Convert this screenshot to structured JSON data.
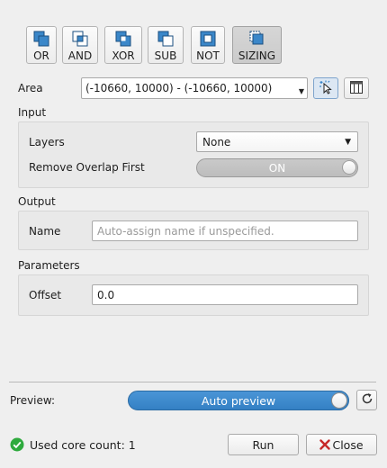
{
  "operations": [
    {
      "id": "or",
      "label": "OR",
      "icon": "or-icon",
      "active": false
    },
    {
      "id": "and",
      "label": "AND",
      "icon": "and-icon",
      "active": false
    },
    {
      "id": "xor",
      "label": "XOR",
      "icon": "xor-icon",
      "active": false
    },
    {
      "id": "sub",
      "label": "SUB",
      "icon": "sub-icon",
      "active": false
    },
    {
      "id": "not",
      "label": "NOT",
      "icon": "not-icon",
      "active": false
    },
    {
      "id": "sizing",
      "label": "SIZING",
      "icon": "sizing-icon",
      "active": true
    }
  ],
  "area": {
    "label": "Area",
    "value": "(-10660, 10000) - (-10660, 10000)",
    "pick_icon": "pick-area-icon",
    "layout_icon": "layout-window-icon"
  },
  "input": {
    "title": "Input",
    "layers_label": "Layers",
    "layers_value": "None",
    "remove_overlap_label": "Remove Overlap First",
    "remove_overlap_value": "ON"
  },
  "output": {
    "title": "Output",
    "name_label": "Name",
    "name_placeholder": "Auto-assign name if unspecified."
  },
  "parameters": {
    "title": "Parameters",
    "offset_label": "Offset",
    "offset_value": "0.0"
  },
  "preview": {
    "label": "Preview:",
    "toggle_text": "Auto preview",
    "refresh_icon": "refresh-icon"
  },
  "footer": {
    "status_icon": "check-circle-icon",
    "status_text": "Used core count: 1",
    "run_label": "Run",
    "close_label": "Close",
    "close_icon": "close-x-icon"
  },
  "colors": {
    "accent": "#3b87c9",
    "status_ok": "#2eaa3d",
    "close_red": "#c62828"
  }
}
